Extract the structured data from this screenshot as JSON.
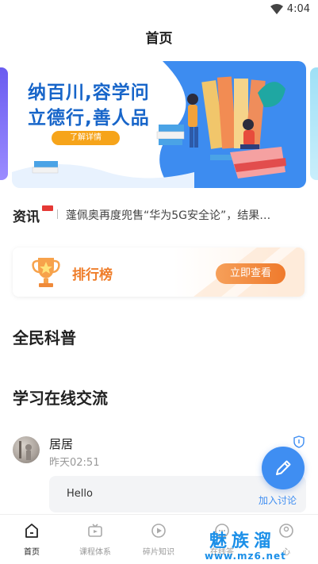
{
  "status_bar": {
    "time": "4:04"
  },
  "header": {
    "title": "首页"
  },
  "banner": {
    "line1": "纳百川,容学问",
    "line2": "立德行,善人品",
    "button_label": "了解详情"
  },
  "news": {
    "tag": "资讯",
    "headline": "蓬佩奥再度兜售“华为5G安全论”，结果…"
  },
  "ranking": {
    "label": "排行榜",
    "button_label": "立即查看"
  },
  "sections": {
    "science": "全民科普",
    "discussion": "学习在线交流"
  },
  "post": {
    "author": "居居",
    "time": "昨天02:51",
    "content": "Hello"
  },
  "fab": {
    "label": "加入讨论"
  },
  "tabs": [
    {
      "label": "首页",
      "icon": "home-icon"
    },
    {
      "label": "课程体系",
      "icon": "tv-icon"
    },
    {
      "label": "碎片知识",
      "icon": "play-icon"
    },
    {
      "label": "在线答",
      "icon": "chat-icon"
    },
    {
      "label": "心",
      "icon": "user-icon"
    }
  ],
  "watermark": {
    "brand": "魅族溜",
    "url": "www.mz6.net"
  },
  "colors": {
    "accent": "#3f8ef2",
    "orange": "#ef7a2c",
    "title_blue": "#1765c9",
    "news_red": "#e53935"
  }
}
